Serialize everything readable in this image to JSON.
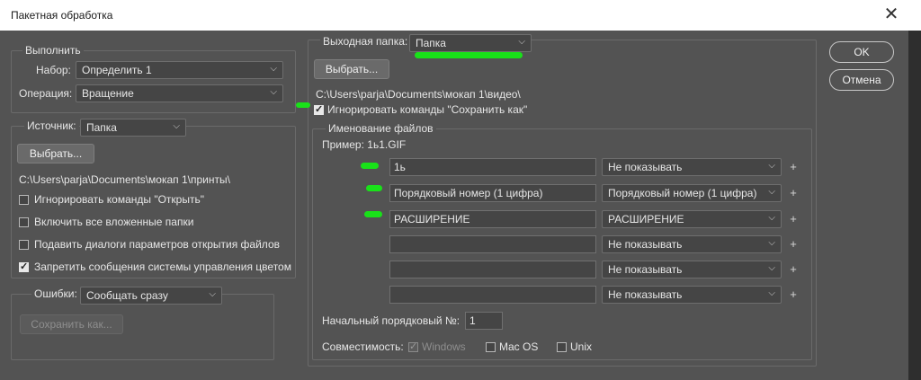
{
  "window": {
    "title": "Пакетная обработка",
    "close_icon": "close-icon"
  },
  "run": {
    "legend": "Выполнить",
    "set_label": "Набор:",
    "set_value": "Определить 1",
    "operation_label": "Операция:",
    "operation_value": "Вращение"
  },
  "source": {
    "label": "Источник:",
    "value": "Папка",
    "choose_button": "Выбрать...",
    "path": "C:\\Users\\parja\\Documents\\мокап 1\\принты\\",
    "options": [
      {
        "label": "Игнорировать команды \"Открыть\"",
        "checked": false
      },
      {
        "label": "Включить все вложенные папки",
        "checked": false
      },
      {
        "label": "Подавить диалоги параметров открытия файлов",
        "checked": false
      },
      {
        "label": "Запретить сообщения системы управления цветом",
        "checked": true
      }
    ]
  },
  "errors": {
    "label": "Ошибки:",
    "value": "Сообщать сразу",
    "save_button": "Сохранить как..."
  },
  "output": {
    "label": "Выходная папка:",
    "value": "Папка",
    "choose_button": "Выбрать...",
    "path": "C:\\Users\\parja\\Documents\\мокап 1\\видео\\",
    "ignore_save_as": {
      "label": "Игнорировать команды \"Сохранить как\"",
      "checked": true
    }
  },
  "naming": {
    "legend": "Именование файлов",
    "example": "Пример: 1ь1.GIF",
    "rows": [
      {
        "text": "1ь",
        "select": "Не показывать"
      },
      {
        "text": "Порядковый номер (1 цифра)",
        "select": "Порядковый номер (1 цифра)"
      },
      {
        "text": "РАСШИРЕНИЕ",
        "select": "РАСШИРЕНИЕ"
      },
      {
        "text": "",
        "select": "Не показывать"
      },
      {
        "text": "",
        "select": "Не показывать"
      },
      {
        "text": "",
        "select": "Не показывать"
      }
    ],
    "plus": "+",
    "start_serial_label": "Начальный порядковый №:",
    "start_serial_value": "1",
    "compat_label": "Совместимость:",
    "compat": [
      {
        "label": "Windows",
        "checked": true,
        "disabled": true
      },
      {
        "label": "Mac OS",
        "checked": false
      },
      {
        "label": "Unix",
        "checked": false
      }
    ]
  },
  "actions": {
    "ok": "OK",
    "cancel": "Отмена"
  },
  "colors": {
    "dialog_bg": "#535353",
    "annotation_marker": "#19e119"
  }
}
